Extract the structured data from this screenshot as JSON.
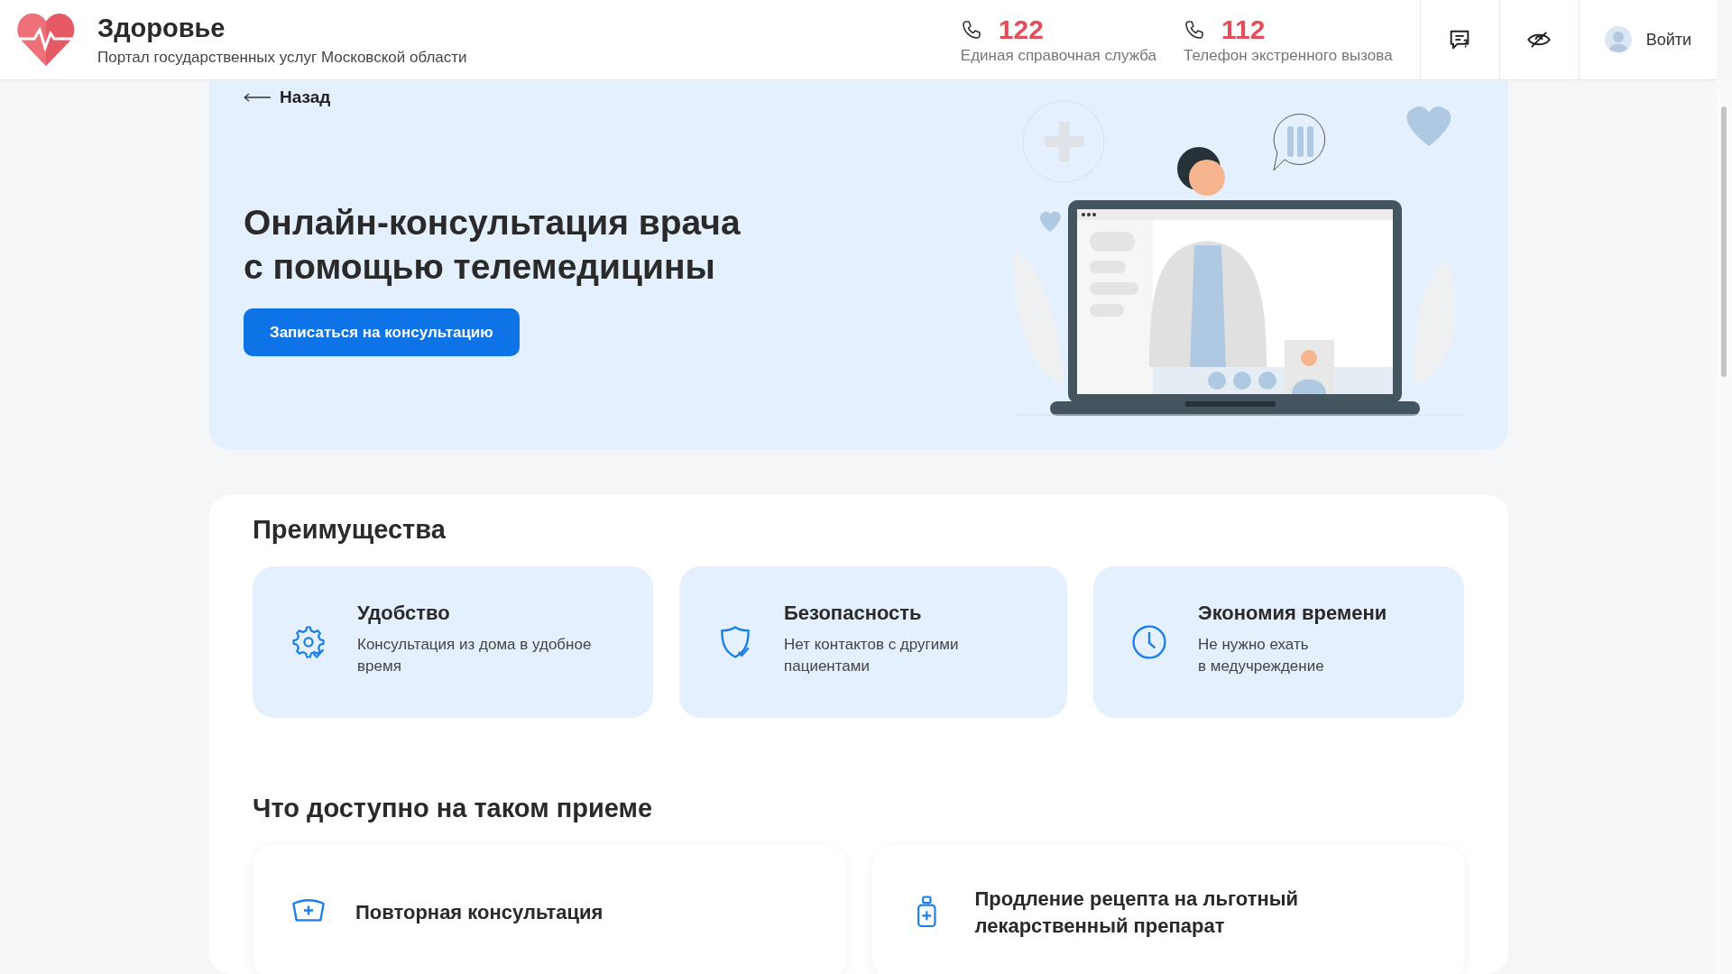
{
  "header": {
    "title": "Здоровье",
    "subtitle": "Портал государственных услуг Московской области",
    "phones": [
      {
        "number": "122",
        "label": "Единая справочная служба"
      },
      {
        "number": "112",
        "label": "Телефон экстренного вызова"
      }
    ],
    "login": "Войти"
  },
  "hero": {
    "back": "Назад",
    "title_lines": [
      "Онлайн-консультация врача",
      "с помощью телемедицины"
    ],
    "button": "Записаться на консультацию"
  },
  "advantages": {
    "title": "Преимущества",
    "items": [
      {
        "kind": "gear",
        "title": "Удобство",
        "text_lines": [
          "Консультация из дома в удобное",
          "время"
        ]
      },
      {
        "kind": "shield",
        "title": "Безопасность",
        "text_lines": [
          "Нет контактов с другими",
          "пациентами"
        ]
      },
      {
        "kind": "clock",
        "title": "Экономия времени",
        "text_lines": [
          "Не нужно ехать",
          "в медучреждение"
        ]
      }
    ]
  },
  "services": {
    "title": "Что доступно на таком приеме",
    "items": [
      {
        "kind": "cap",
        "title_lines": [
          "Повторная консультация"
        ]
      },
      {
        "kind": "bottle",
        "title_lines": [
          "Продление рецепта на льготный",
          "лекарственный препарат"
        ]
      }
    ]
  }
}
